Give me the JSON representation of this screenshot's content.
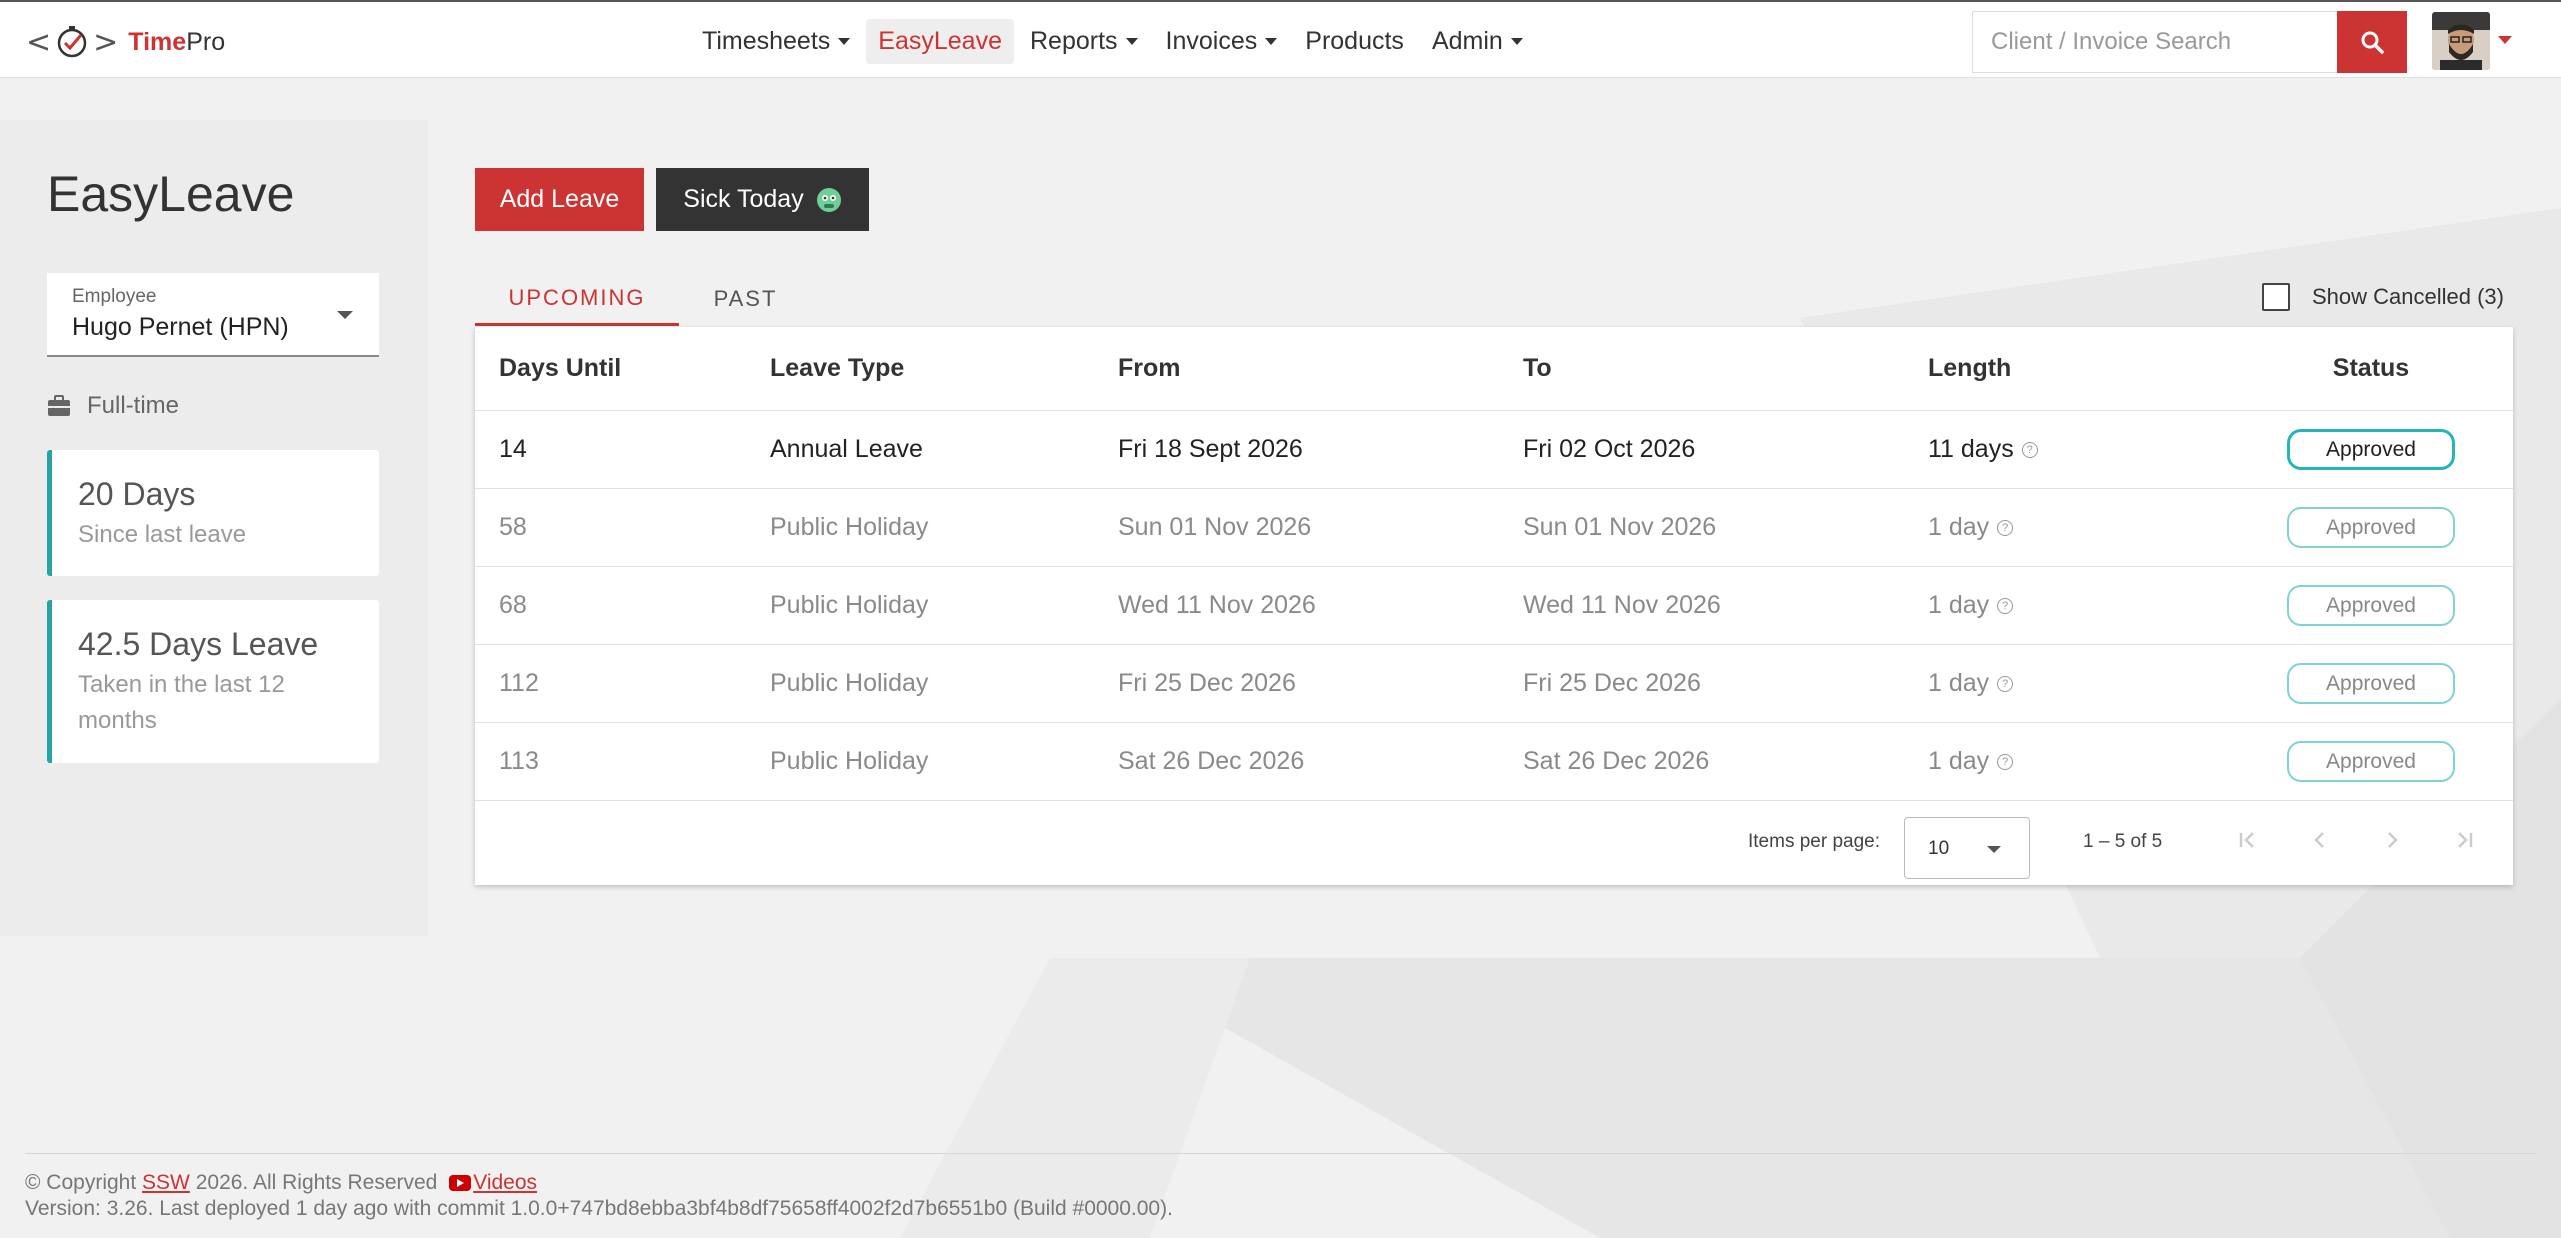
{
  "header": {
    "logo_text_red": "Time",
    "logo_text_dark": "Pro",
    "nav": [
      {
        "label": "Timesheets",
        "has_dropdown": true,
        "active": false
      },
      {
        "label": "EasyLeave",
        "has_dropdown": false,
        "active": true
      },
      {
        "label": "Reports",
        "has_dropdown": true,
        "active": false
      },
      {
        "label": "Invoices",
        "has_dropdown": true,
        "active": false
      },
      {
        "label": "Products",
        "has_dropdown": false,
        "active": false
      },
      {
        "label": "Admin",
        "has_dropdown": true,
        "active": false
      }
    ],
    "search_placeholder": "Client / Invoice Search",
    "search_value": ""
  },
  "sidebar": {
    "title": "EasyLeave",
    "employee_label": "Employee",
    "employee_value": "Hugo Pernet (HPN)",
    "employment_type": "Full-time",
    "cards": [
      {
        "big": "20 Days",
        "small": "Since last leave"
      },
      {
        "big": "42.5 Days Leave",
        "small": "Taken in the last 12 months"
      }
    ]
  },
  "actions": {
    "add_leave": "Add Leave",
    "sick_today": "Sick Today"
  },
  "tabs": [
    {
      "label": "UPCOMING",
      "active": true
    },
    {
      "label": "PAST",
      "active": false
    }
  ],
  "show_cancelled": {
    "label": "Show Cancelled (3)",
    "checked": false
  },
  "table": {
    "columns": [
      "Days Until",
      "Leave Type",
      "From",
      "To",
      "Length",
      "Status"
    ],
    "rows": [
      {
        "days_until": "14",
        "leave_type": "Annual Leave",
        "from": "Fri 18 Sept 2026",
        "to": "Fri 02 Oct 2026",
        "length": "11 days",
        "status": "Approved"
      },
      {
        "days_until": "58",
        "leave_type": "Public Holiday",
        "from": "Sun 01 Nov 2026",
        "to": "Sun 01 Nov 2026",
        "length": "1 day",
        "status": "Approved"
      },
      {
        "days_until": "68",
        "leave_type": "Public Holiday",
        "from": "Wed 11 Nov 2026",
        "to": "Wed 11 Nov 2026",
        "length": "1 day",
        "status": "Approved"
      },
      {
        "days_until": "112",
        "leave_type": "Public Holiday",
        "from": "Fri 25 Dec 2026",
        "to": "Fri 25 Dec 2026",
        "length": "1 day",
        "status": "Approved"
      },
      {
        "days_until": "113",
        "leave_type": "Public Holiday",
        "from": "Sat 26 Dec 2026",
        "to": "Sat 26 Dec 2026",
        "length": "1 day",
        "status": "Approved"
      }
    ],
    "paginator": {
      "items_per_page_label": "Items per page:",
      "items_per_page": "10",
      "range": "1 – 5 of 5"
    }
  },
  "footer": {
    "copyright_prefix": "© Copyright",
    "company": "SSW",
    "copyright_suffix": "2026. All Rights Reserved",
    "videos": "Videos",
    "version": "Version: 3.26. Last deployed 1 day ago with commit 1.0.0+747bd8ebba3bf4b8df75658ff4002f2d7b6551b0 (Build #0000.00)."
  },
  "colors": {
    "brand_red": "#cc3333",
    "teal": "#26a3a3",
    "dark_button": "#333333"
  }
}
